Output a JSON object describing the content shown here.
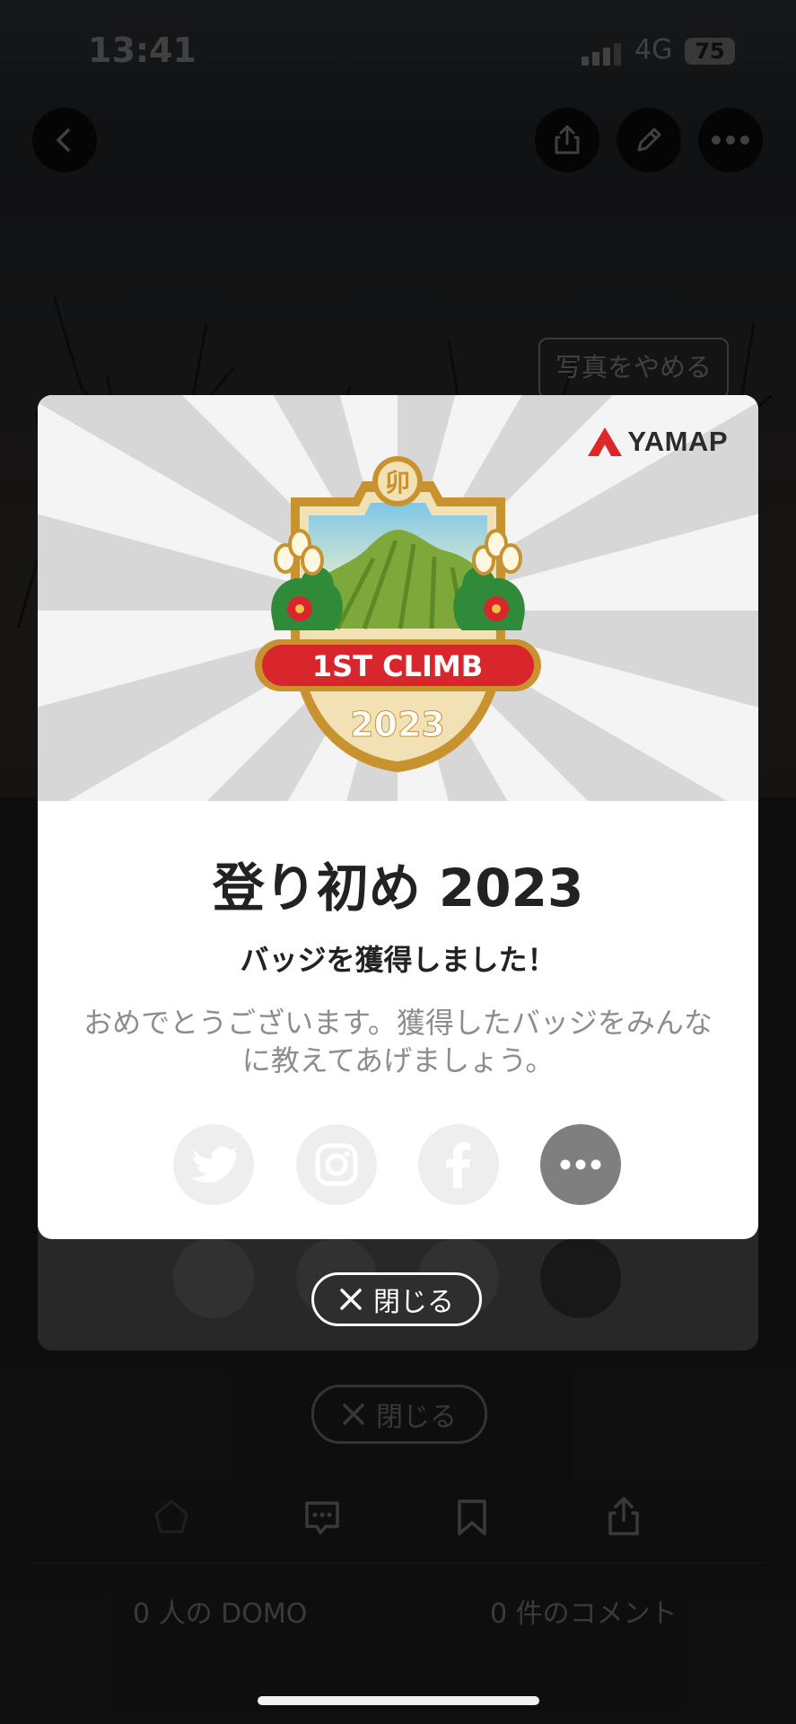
{
  "status_bar": {
    "time": "13:41",
    "network": "4G",
    "battery": "75"
  },
  "photo_overlay": {
    "remove_photo_label": "写真をやめる"
  },
  "modal": {
    "brand": "YAMAP",
    "badge": {
      "kanji": "卯",
      "banner": "1ST CLIMB",
      "year": "2023"
    },
    "title": "登り初め 2023",
    "subtitle": "バッジを獲得しました！",
    "description": "おめでとうございます。獲得したバッジをみんなに教えてあげましょう。",
    "share_icons": [
      "twitter-icon",
      "instagram-icon",
      "facebook-icon",
      "more-icon"
    ],
    "close_label": "閉じる"
  },
  "background": {
    "close_label": "閉じる",
    "domo_count_label": "0 人の DOMO",
    "comment_count_label": "0 件のコメント"
  },
  "colors": {
    "badge_red": "#d8262c",
    "badge_gold": "#c8922f",
    "more_grey": "#7f7f7f",
    "brand_red": "#e0262a"
  }
}
